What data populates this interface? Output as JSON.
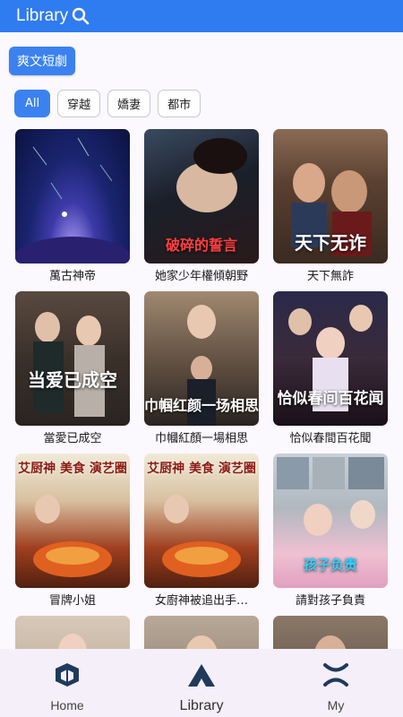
{
  "header": {
    "title": "Library"
  },
  "category": {
    "label": "爽文短劇"
  },
  "filters": [
    {
      "label": "All"
    },
    {
      "label": "穿越"
    },
    {
      "label": "嬌妻"
    },
    {
      "label": "都市"
    }
  ],
  "cards": [
    {
      "title": "萬古神帝",
      "poster_text": ""
    },
    {
      "title": "她家少年權傾朝野",
      "poster_text": "破碎的誓言"
    },
    {
      "title": "天下無詐",
      "poster_text": "天下无诈"
    },
    {
      "title": "當愛已成空",
      "poster_text": "当爱已成空"
    },
    {
      "title": "巾幗紅顏一場相思",
      "poster_text": "巾帼红颜一场相思"
    },
    {
      "title": "恰似春間百花聞",
      "poster_text": "恰似春间百花闻"
    },
    {
      "title": "冒牌小姐",
      "poster_text": "艾厨神 美食 演艺圈"
    },
    {
      "title": "女廚神被追出手…",
      "poster_text": "艾厨神 美食 演艺圈"
    },
    {
      "title": "請對孩子負責",
      "poster_text": "孩子负责"
    },
    {
      "title": "",
      "poster_text": ""
    },
    {
      "title": "",
      "poster_text": ""
    },
    {
      "title": "",
      "poster_text": ""
    }
  ],
  "nav": {
    "home": "Home",
    "library": "Library",
    "my": "My"
  },
  "colors": {
    "accent": "#2f7bf0",
    "nav_bg": "#f4eff8"
  }
}
